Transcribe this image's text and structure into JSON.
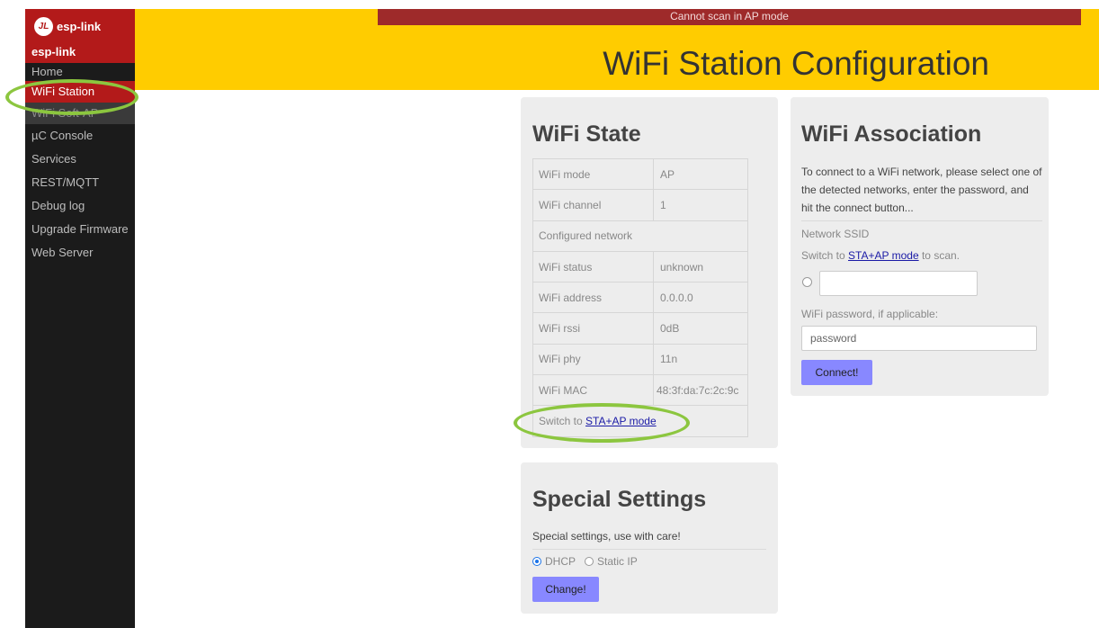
{
  "sidebar": {
    "brand": "esp-link",
    "brand_logo": "JL",
    "heading": "esp-link",
    "items": [
      {
        "label": "Home"
      },
      {
        "label": "WiFi Station"
      },
      {
        "label": "WiFi Soft-AP"
      },
      {
        "label": "µC Console"
      },
      {
        "label": "Services"
      },
      {
        "label": "REST/MQTT"
      },
      {
        "label": "Debug log"
      },
      {
        "label": "Upgrade Firmware"
      },
      {
        "label": "Web Server"
      }
    ]
  },
  "header": {
    "notice": "Cannot scan in AP mode",
    "title": "WiFi Station Configuration"
  },
  "wifi_state": {
    "title": "WiFi State",
    "rows": [
      {
        "label": "WiFi mode",
        "value": "AP"
      },
      {
        "label": "WiFi channel",
        "value": "1"
      },
      {
        "label": "Configured network",
        "value": ""
      },
      {
        "label": "WiFi status",
        "value": "unknown"
      },
      {
        "label": "WiFi address",
        "value": "0.0.0.0"
      },
      {
        "label": "WiFi rssi",
        "value": "0dB"
      },
      {
        "label": "WiFi phy",
        "value": "11n"
      },
      {
        "label": "WiFi MAC",
        "value": "48:3f:da:7c:2c:9c"
      }
    ],
    "switch_prefix": "Switch to ",
    "switch_link": "STA+AP mode"
  },
  "wifi_association": {
    "title": "WiFi Association",
    "intro": "To connect to a WiFi network, please select one of the detected networks, enter the password, and hit the connect button...",
    "ssid_label": "Network SSID",
    "switch_prefix": "Switch to ",
    "switch_link": "STA+AP mode",
    "switch_suffix": " to scan.",
    "ssid_value": "",
    "password_label": "WiFi password, if applicable:",
    "password_placeholder": "password",
    "connect_button": "Connect!"
  },
  "special_settings": {
    "title": "Special Settings",
    "description": "Special settings, use with care!",
    "option_dhcp": "DHCP",
    "option_static": "Static IP",
    "selected": "DHCP",
    "change_button": "Change!"
  },
  "colors": {
    "sidebar_bg": "#1b1b1b",
    "accent_red": "#b31a1a",
    "header_yellow": "#ffcc00",
    "button_purple": "#8888ff",
    "highlight_green": "#8cc63f"
  }
}
